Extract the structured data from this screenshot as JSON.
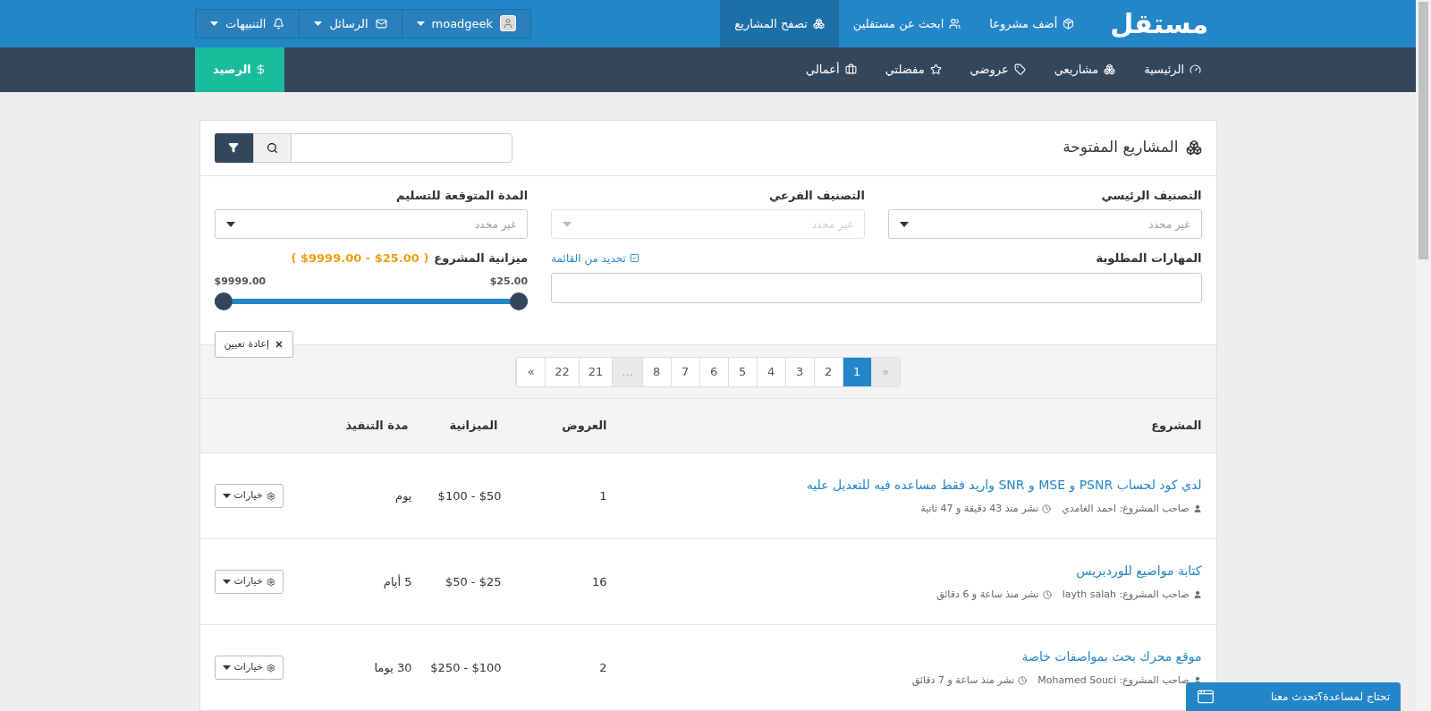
{
  "topbar": {
    "logo": "مستقل",
    "nav": [
      {
        "label": "أضف مشروعا",
        "selected": false
      },
      {
        "label": "ابحث عن مستقلين",
        "selected": false
      },
      {
        "label": "تصفح المشاريع",
        "selected": true
      }
    ],
    "menus": [
      {
        "kind": "user",
        "label": "moadgeek"
      },
      {
        "kind": "messages",
        "label": "الرسائل"
      },
      {
        "kind": "notifications",
        "label": "التنبيهات"
      }
    ]
  },
  "subnav": {
    "items": [
      {
        "label": "الرئيسية"
      },
      {
        "label": "مشاريعي"
      },
      {
        "label": "عروضي"
      },
      {
        "label": "مفضلتي"
      },
      {
        "label": "أعمالي"
      }
    ],
    "balance_button": "الرصيد"
  },
  "panel": {
    "title": "المشاريع المفتوحة",
    "filters": {
      "main_category": {
        "label": "التصنيف الرئيسي",
        "placeholder": "غير محدد",
        "disabled": false
      },
      "subcategory": {
        "label": "التصنيف الفرعي",
        "placeholder": "غير محدد",
        "disabled": true
      },
      "duration": {
        "label": "المدة المتوقعة للتسليم",
        "placeholder": "غير محدد",
        "disabled": false
      },
      "skills": {
        "label": "المهارات المطلوبة",
        "link": "تحديد من القائمة"
      },
      "budget": {
        "label": "ميزانية المشروع",
        "range_open": "(",
        "range": "$25.00 - $9999.00",
        "range_close": ")",
        "min": "$25.00",
        "max": "$9999.00",
        "level": 1
      },
      "reset_button": "إعادة تعيين"
    },
    "pagination": [
      {
        "label": "«",
        "selected": false,
        "disabled": true
      },
      {
        "label": "1",
        "selected": true,
        "disabled": false
      },
      {
        "label": "2",
        "selected": false,
        "disabled": false
      },
      {
        "label": "3",
        "selected": false,
        "disabled": false
      },
      {
        "label": "4",
        "selected": false,
        "disabled": false
      },
      {
        "label": "5",
        "selected": false,
        "disabled": false
      },
      {
        "label": "6",
        "selected": false,
        "disabled": false
      },
      {
        "label": "7",
        "selected": false,
        "disabled": false
      },
      {
        "label": "8",
        "selected": false,
        "disabled": false
      },
      {
        "label": "...",
        "selected": false,
        "disabled": true
      },
      {
        "label": "21",
        "selected": false,
        "disabled": false
      },
      {
        "label": "22",
        "selected": false,
        "disabled": false
      },
      {
        "label": "»",
        "selected": false,
        "disabled": false
      }
    ],
    "table": {
      "columns": [
        "المشروع",
        "العروض",
        "الميزانية",
        "مدة التنفيذ"
      ],
      "rows": [
        {
          "title": "لدي كود لحساب PSNR و MSE و SNR واريد فقط مساعده فيه للتعديل عليه",
          "owner": "صاحب المشروع: احمد الغامدي",
          "posted": "نشر منذ 43 دقيقة و 47 ثانية",
          "bids": "1",
          "budget": "$50 - $100",
          "duration": "يوم",
          "options": "خيارات"
        },
        {
          "title": "كتابة مواضيع للوردبريس",
          "owner": "صاحب المشروع: layth salah",
          "posted": "نشر منذ ساعة و 6 دقائق",
          "bids": "16",
          "budget": "$25 - $50",
          "duration": "5 أيام",
          "options": "خيارات"
        },
        {
          "title": "موقع محرك بحث بمواصفات خاصة",
          "owner": "صاحب المشروع: Mohamed Souci",
          "posted": "نشر منذ ساعة و 7 دقائق",
          "bids": "2",
          "budget": "$100 - $250",
          "duration": "30 يوما",
          "options": "خيارات"
        }
      ]
    }
  },
  "chat_widget": {
    "label": "تحتاج لمساعدة؟تحدث معنا"
  }
}
